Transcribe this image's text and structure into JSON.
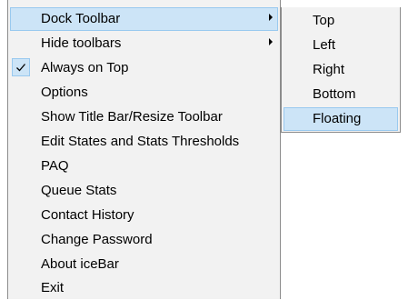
{
  "main_menu": {
    "items": [
      {
        "label": "Dock Toolbar",
        "has_submenu": true,
        "highlighted": true,
        "checked": false
      },
      {
        "label": "Hide toolbars",
        "has_submenu": true,
        "highlighted": false,
        "checked": false
      },
      {
        "label": "Always on Top",
        "has_submenu": false,
        "highlighted": false,
        "checked": true
      },
      {
        "label": "Options",
        "has_submenu": false,
        "highlighted": false,
        "checked": false
      },
      {
        "label": "Show Title Bar/Resize Toolbar",
        "has_submenu": false,
        "highlighted": false,
        "checked": false
      },
      {
        "label": "Edit States and Stats Thresholds",
        "has_submenu": false,
        "highlighted": false,
        "checked": false
      },
      {
        "label": "PAQ",
        "has_submenu": false,
        "highlighted": false,
        "checked": false
      },
      {
        "label": "Queue Stats",
        "has_submenu": false,
        "highlighted": false,
        "checked": false
      },
      {
        "label": "Contact History",
        "has_submenu": false,
        "highlighted": false,
        "checked": false
      },
      {
        "label": "Change Password",
        "has_submenu": false,
        "highlighted": false,
        "checked": false
      },
      {
        "label": "About iceBar",
        "has_submenu": false,
        "highlighted": false,
        "checked": false
      },
      {
        "label": "Exit",
        "has_submenu": false,
        "highlighted": false,
        "checked": false
      }
    ]
  },
  "dock_submenu": {
    "items": [
      {
        "label": "Top",
        "highlighted": false
      },
      {
        "label": "Left",
        "highlighted": false
      },
      {
        "label": "Right",
        "highlighted": false
      },
      {
        "label": "Bottom",
        "highlighted": false
      },
      {
        "label": "Floating",
        "highlighted": true
      }
    ]
  },
  "colors": {
    "menu_background": "#f2f2f2",
    "highlight_fill": "#cce4f7",
    "highlight_border": "#99c9ef",
    "menu_border": "#8c8c8c"
  },
  "icons": {
    "checkmark": "checkmark-icon",
    "submenu_arrow": "chevron-right-icon"
  }
}
